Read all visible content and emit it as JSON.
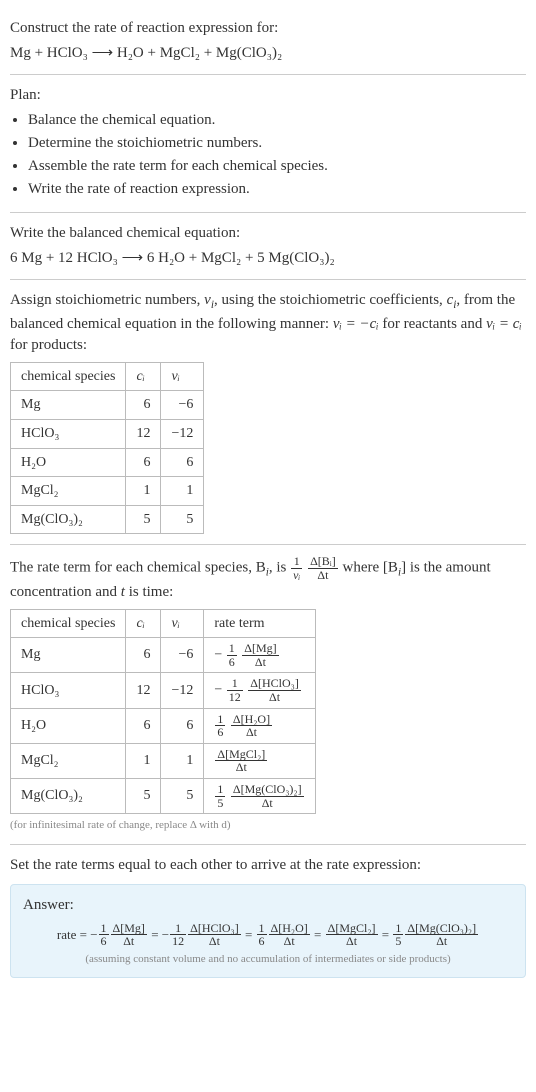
{
  "intro": {
    "title": "Construct the rate of reaction expression for:",
    "equation": "Mg + HClO₃  ⟶  H₂O + MgCl₂ + Mg(ClO₃)₂"
  },
  "plan": {
    "label": "Plan:",
    "items": [
      "Balance the chemical equation.",
      "Determine the stoichiometric numbers.",
      "Assemble the rate term for each chemical species.",
      "Write the rate of reaction expression."
    ]
  },
  "balanced": {
    "label": "Write the balanced chemical equation:",
    "equation": "6 Mg + 12 HClO₃  ⟶  6 H₂O + MgCl₂ + 5 Mg(ClO₃)₂"
  },
  "assign": {
    "text_a": "Assign stoichiometric numbers, ",
    "nu": "ν",
    "sub_i": "i",
    "text_b": ", using the stoichiometric coefficients, ",
    "c": "c",
    "text_c": ", from the balanced chemical equation in the following manner: ",
    "rel_react": "νᵢ = −cᵢ",
    "text_d": " for reactants and ",
    "rel_prod": "νᵢ = cᵢ",
    "text_e": " for products:"
  },
  "table1": {
    "headers": [
      "chemical species",
      "cᵢ",
      "νᵢ"
    ],
    "rows": [
      {
        "sp": "Mg",
        "c": "6",
        "nu": "−6"
      },
      {
        "sp": "HClO₃",
        "c": "12",
        "nu": "−12"
      },
      {
        "sp": "H₂O",
        "c": "6",
        "nu": "6"
      },
      {
        "sp": "MgCl₂",
        "c": "1",
        "nu": "1"
      },
      {
        "sp": "Mg(ClO₃)₂",
        "c": "5",
        "nu": "5"
      }
    ]
  },
  "rate_term_intro": {
    "a": "The rate term for each chemical species, B",
    "b": ", is ",
    "frac1_top": "1",
    "frac1_bot": "νᵢ",
    "frac2_top": "Δ[Bᵢ]",
    "frac2_bot": "Δt",
    "c": " where [B",
    "d": "] is the amount concentration and ",
    "t": "t",
    "e": " is time:"
  },
  "table2": {
    "headers": [
      "chemical species",
      "cᵢ",
      "νᵢ",
      "rate term"
    ],
    "rows": [
      {
        "sp": "Mg",
        "c": "6",
        "nu": "−6",
        "neg": "−",
        "ft": "1",
        "fb": "6",
        "gt": "Δ[Mg]",
        "gb": "Δt"
      },
      {
        "sp": "HClO₃",
        "c": "12",
        "nu": "−12",
        "neg": "−",
        "ft": "1",
        "fb": "12",
        "gt": "Δ[HClO₃]",
        "gb": "Δt"
      },
      {
        "sp": "H₂O",
        "c": "6",
        "nu": "6",
        "neg": "",
        "ft": "1",
        "fb": "6",
        "gt": "Δ[H₂O]",
        "gb": "Δt"
      },
      {
        "sp": "MgCl₂",
        "c": "1",
        "nu": "1",
        "neg": "",
        "ft": "",
        "fb": "",
        "gt": "Δ[MgCl₂]",
        "gb": "Δt"
      },
      {
        "sp": "Mg(ClO₃)₂",
        "c": "5",
        "nu": "5",
        "neg": "",
        "ft": "1",
        "fb": "5",
        "gt": "Δ[Mg(ClO₃)₂]",
        "gb": "Δt"
      }
    ],
    "note": "(for infinitesimal rate of change, replace Δ with d)"
  },
  "final": {
    "intro": "Set the rate terms equal to each other to arrive at the rate expression:",
    "answer_label": "Answer:",
    "rate_prefix": "rate = ",
    "terms": [
      {
        "neg": "−",
        "ft": "1",
        "fb": "6",
        "gt": "Δ[Mg]",
        "gb": "Δt"
      },
      {
        "neg": "−",
        "ft": "1",
        "fb": "12",
        "gt": "Δ[HClO₃]",
        "gb": "Δt"
      },
      {
        "neg": "",
        "ft": "1",
        "fb": "6",
        "gt": "Δ[H₂O]",
        "gb": "Δt"
      },
      {
        "neg": "",
        "ft": "",
        "fb": "",
        "gt": "Δ[MgCl₂]",
        "gb": "Δt"
      },
      {
        "neg": "",
        "ft": "1",
        "fb": "5",
        "gt": "Δ[Mg(ClO₃)₂]",
        "gb": "Δt"
      }
    ],
    "eq": " = ",
    "assume": "(assuming constant volume and no accumulation of intermediates or side products)"
  }
}
